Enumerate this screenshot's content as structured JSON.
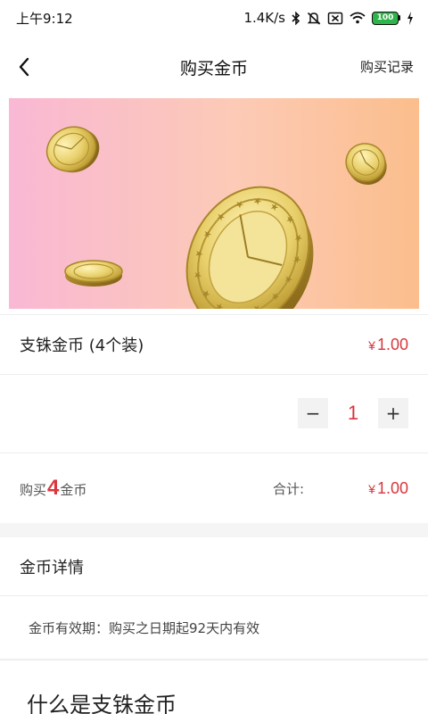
{
  "status_bar": {
    "time": "上午9:12",
    "network_speed": "1.4K/s",
    "battery_level": "100",
    "icons": [
      "bluetooth-icon",
      "mute-icon",
      "no-sim-icon",
      "wifi-icon",
      "battery-icon",
      "charging-icon"
    ]
  },
  "nav": {
    "title": "购买金币",
    "record_link": "购买记录",
    "back_icon": "chevron-left-icon"
  },
  "banner": {
    "description_icon": "gold-coins-illustration",
    "gradient_colors": [
      "#f9b8d4",
      "#fccab6",
      "#fbbe8c"
    ]
  },
  "product": {
    "name": "支铢金币 (4个装)",
    "price_symbol": "¥",
    "price": "1.00"
  },
  "quantity": {
    "minus": "−",
    "value": "1",
    "plus": "+"
  },
  "total": {
    "buy_prefix": "购买",
    "buy_count": "4",
    "buy_suffix": "金币",
    "label": "合计:",
    "price_symbol": "¥",
    "price": "1.00"
  },
  "details": {
    "header": "金币详情",
    "validity": "金币有效期：购买之日期起92天内有效",
    "what_heading": "什么是支铢金币"
  },
  "colors": {
    "accent": "#d9363e",
    "divider": "#f5f5f5"
  }
}
